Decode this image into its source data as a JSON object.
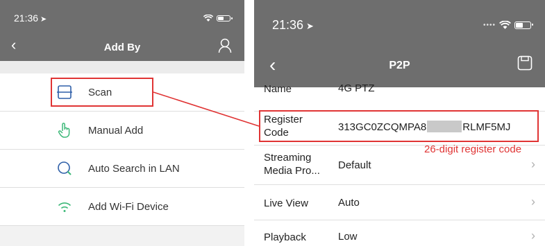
{
  "left_screen": {
    "status": {
      "time": "21:36"
    },
    "nav": {
      "title": "Add By"
    },
    "menu": [
      {
        "label": "Scan",
        "icon": "scan-icon"
      },
      {
        "label": "Manual Add",
        "icon": "hand-pointer-icon"
      },
      {
        "label": "Auto Search in LAN",
        "icon": "search-icon"
      },
      {
        "label": "Add Wi-Fi Device",
        "icon": "wifi-icon"
      }
    ]
  },
  "right_screen": {
    "status": {
      "time": "21:36"
    },
    "nav": {
      "title": "P2P"
    },
    "rows": [
      {
        "key": "Name",
        "value": "4G PTZ"
      },
      {
        "key": "Register Code",
        "value_prefix": "313GC0ZCQMPA8",
        "value_suffix": "RLMF5MJ"
      },
      {
        "key": "Streaming Media Pro...",
        "value": "Default"
      },
      {
        "key": "Live View",
        "value": "Auto"
      },
      {
        "key": "Playback",
        "value": "Low"
      }
    ]
  },
  "annotation": {
    "text": "26-digit register code",
    "color": "#e03434"
  },
  "colors": {
    "nav_bg": "#6e6e6e",
    "highlight": "#e03434",
    "icon_green": "#3cb878",
    "icon_blue": "#2e5fa8"
  }
}
